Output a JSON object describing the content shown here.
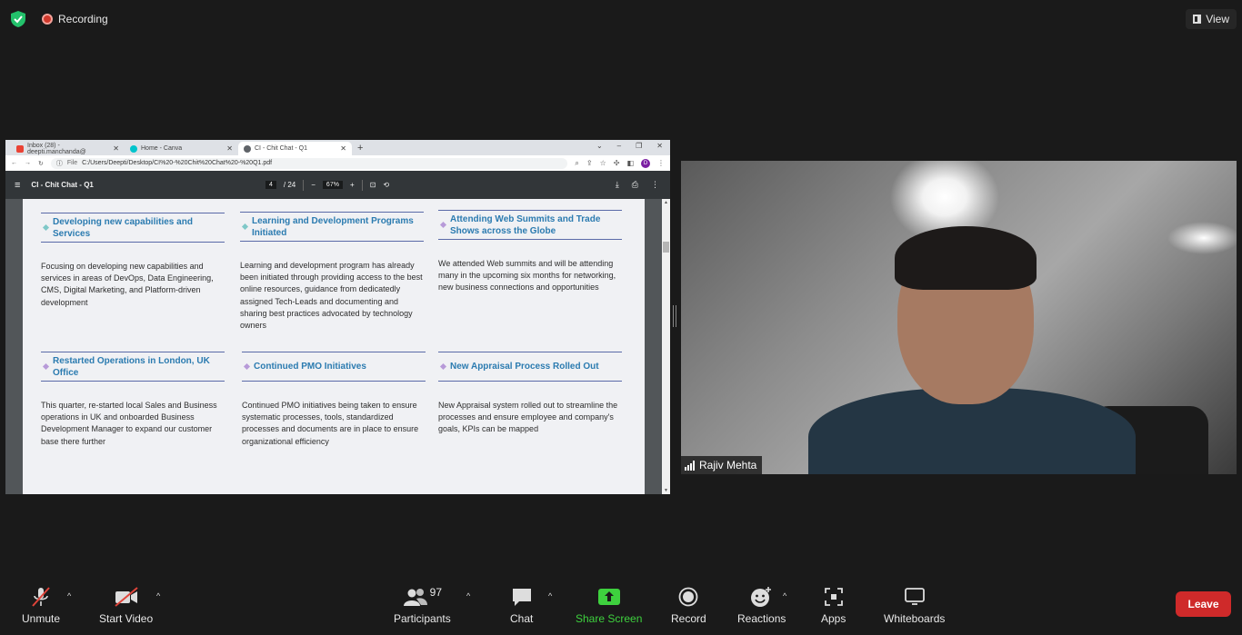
{
  "top": {
    "recording_label": "Recording",
    "view_label": "View"
  },
  "browser": {
    "tabs": [
      {
        "label": "Inbox (28) - deepti.manchanda@",
        "color": "#ea4335"
      },
      {
        "label": "Home - Canva",
        "color": "#00c4cc"
      },
      {
        "label": "CI - Chit Chat - Q1",
        "color": "#5f6368"
      }
    ],
    "new_tab": "+",
    "url_prefix": "File",
    "url": "C:/Users/Deepti/Desktop/CI%20-%20Chit%20Chat%20-%20Q1.pdf",
    "avatar_letter": "D"
  },
  "pdf": {
    "title": "CI - Chit Chat - Q1",
    "page_current": "4",
    "page_total": "/ 24",
    "zoom": "67%",
    "cards": [
      {
        "title": "Developing new capabilities and Services",
        "body": "Focusing on developing new capabilities and services in areas of DevOps, Data Engineering, CMS, Digital Marketing, and Platform-driven development",
        "diamond": "#7fc8c8"
      },
      {
        "title": "Learning and Development Programs Initiated",
        "body": "Learning and development program has already been initiated through providing access to the best online resources, guidance from dedicatedly assigned Tech-Leads and documenting and sharing best practices advocated by technology owners",
        "diamond": "#7fc8c8"
      },
      {
        "title": "Attending Web Summits and Trade Shows across the Globe",
        "body": "We attended Web summits and will be attending many in the upcoming six months for networking, new business connections and opportunities",
        "diamond": "#b79ad8"
      },
      {
        "title": "Restarted Operations in London, UK Office",
        "body": "This quarter, re-started local Sales and Business operations in UK and onboarded Business Development Manager to expand our customer base there further",
        "diamond": "#b79ad8"
      },
      {
        "title": "Continued PMO Initiatives",
        "body": "Continued PMO initiatives being taken to ensure systematic processes, tools, standardized processes and documents are in place to ensure organizational efficiency",
        "diamond": "#b79ad8"
      },
      {
        "title": "New Appraisal Process Rolled Out",
        "body": "New Appraisal system rolled out to streamline the processes and ensure employee and company's goals, KPIs can be mapped",
        "diamond": "#b79ad8"
      }
    ]
  },
  "video": {
    "participant_name": "Rajiv Mehta"
  },
  "toolbar": {
    "unmute": "Unmute",
    "start_video": "Start Video",
    "participants": "Participants",
    "participants_count": "97",
    "chat": "Chat",
    "share_screen": "Share Screen",
    "record": "Record",
    "reactions": "Reactions",
    "apps": "Apps",
    "whiteboards": "Whiteboards",
    "leave": "Leave"
  },
  "colors": {
    "background": "#1a1a1a",
    "share_green": "#3ed13e",
    "leave_red": "#cf2a2a",
    "heading_blue": "#2b7bb0"
  }
}
